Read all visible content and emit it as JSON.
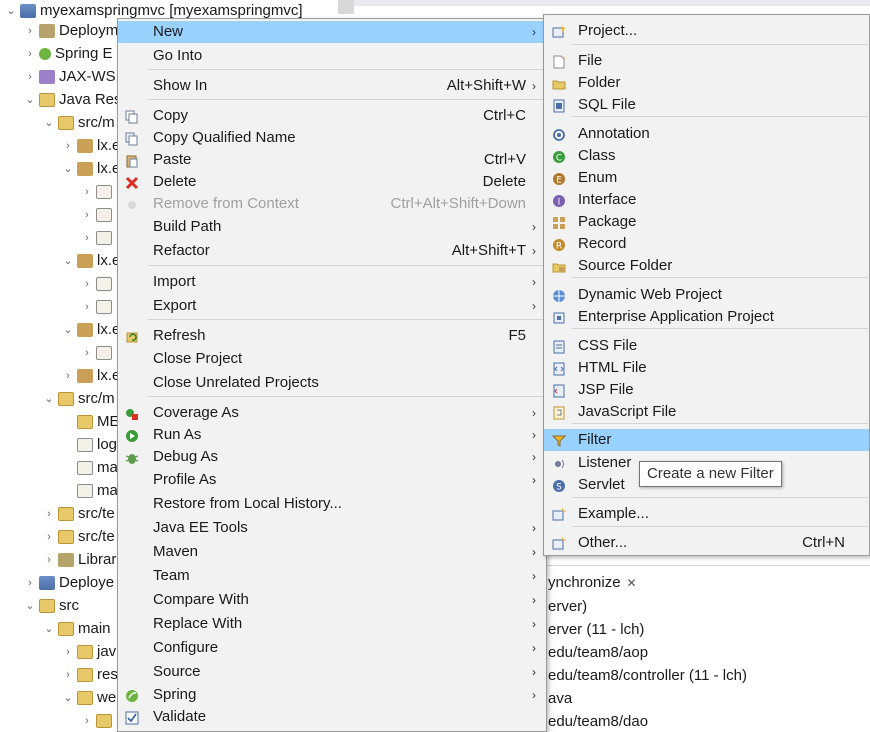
{
  "explorer": {
    "rows": [
      {
        "label": "myexamspringmvc [myexamspringmvc]",
        "icon": "project-icon"
      },
      {
        "label": "Deploym",
        "icon": "deployment-descriptor-icon"
      },
      {
        "label": "Spring E",
        "icon": "spring-icon"
      },
      {
        "label": "JAX-WS",
        "icon": "jaxws-icon"
      },
      {
        "label": "Java Res",
        "icon": "java-resources-icon"
      },
      {
        "label": "src/m",
        "icon": "source-folder-icon"
      },
      {
        "label": "lx.e",
        "icon": "package-icon"
      },
      {
        "label": "lx.e",
        "icon": "package-icon"
      },
      {
        "label": "",
        "icon": "java-file-icon"
      },
      {
        "label": "",
        "icon": "java-file-icon"
      },
      {
        "label": "",
        "icon": "java-file-icon"
      },
      {
        "label": "lx.e",
        "icon": "package-icon"
      },
      {
        "label": "",
        "icon": "java-file-icon"
      },
      {
        "label": "",
        "icon": "java-file-icon"
      },
      {
        "label": "lx.e",
        "icon": "package-icon"
      },
      {
        "label": "",
        "icon": "java-file-icon"
      },
      {
        "label": "lx.e",
        "icon": "package-icon"
      },
      {
        "label": "src/m",
        "icon": "source-folder-icon"
      },
      {
        "label": "ME",
        "icon": "folder-icon"
      },
      {
        "label": "log",
        "icon": "xml-file-icon"
      },
      {
        "label": "ma",
        "icon": "xml-file-icon"
      },
      {
        "label": "ma",
        "icon": "xml-file-icon"
      },
      {
        "label": "src/te",
        "icon": "source-folder-icon"
      },
      {
        "label": "src/te",
        "icon": "source-folder-icon"
      },
      {
        "label": "Librar",
        "icon": "library-icon"
      },
      {
        "label": "Deploye",
        "icon": "deployed-resources-icon"
      },
      {
        "label": "src",
        "icon": "folder-icon"
      },
      {
        "label": "main",
        "icon": "folder-icon"
      },
      {
        "label": "jav",
        "icon": "folder-icon"
      },
      {
        "label": "res",
        "icon": "folder-icon"
      },
      {
        "label": "we",
        "icon": "folder-icon"
      },
      {
        "label": "",
        "icon": "folder-icon"
      }
    ]
  },
  "context_menu": {
    "items": [
      {
        "label": "New",
        "shortcut": "",
        "submenu": true,
        "icon": "",
        "highlight": true
      },
      {
        "label": "Go Into",
        "shortcut": "",
        "submenu": false,
        "icon": ""
      },
      {
        "label": "Show In",
        "shortcut": "Alt+Shift+W",
        "submenu": true,
        "icon": ""
      },
      {
        "label": "Copy",
        "shortcut": "Ctrl+C",
        "submenu": false,
        "icon": "copy-icon"
      },
      {
        "label": "Copy Qualified Name",
        "shortcut": "",
        "submenu": false,
        "icon": "copy-qualified-name-icon"
      },
      {
        "label": "Paste",
        "shortcut": "Ctrl+V",
        "submenu": false,
        "icon": "paste-icon"
      },
      {
        "label": "Delete",
        "shortcut": "Delete",
        "submenu": false,
        "icon": "delete-icon"
      },
      {
        "label": "Remove from Context",
        "shortcut": "Ctrl+Alt+Shift+Down",
        "submenu": false,
        "icon": "remove-from-context-icon",
        "disabled": true
      },
      {
        "label": "Build Path",
        "shortcut": "",
        "submenu": true,
        "icon": ""
      },
      {
        "label": "Refactor",
        "shortcut": "Alt+Shift+T",
        "submenu": true,
        "icon": ""
      },
      {
        "label": "Import",
        "shortcut": "",
        "submenu": true,
        "icon": ""
      },
      {
        "label": "Export",
        "shortcut": "",
        "submenu": true,
        "icon": ""
      },
      {
        "label": "Refresh",
        "shortcut": "F5",
        "submenu": false,
        "icon": "refresh-icon"
      },
      {
        "label": "Close Project",
        "shortcut": "",
        "submenu": false,
        "icon": ""
      },
      {
        "label": "Close Unrelated Projects",
        "shortcut": "",
        "submenu": false,
        "icon": ""
      },
      {
        "label": "Coverage As",
        "shortcut": "",
        "submenu": true,
        "icon": "coverage-icon"
      },
      {
        "label": "Run As",
        "shortcut": "",
        "submenu": true,
        "icon": "run-icon"
      },
      {
        "label": "Debug As",
        "shortcut": "",
        "submenu": true,
        "icon": "debug-icon"
      },
      {
        "label": "Profile As",
        "shortcut": "",
        "submenu": true,
        "icon": ""
      },
      {
        "label": "Restore from Local History...",
        "shortcut": "",
        "submenu": false,
        "icon": ""
      },
      {
        "label": "Java EE Tools",
        "shortcut": "",
        "submenu": true,
        "icon": ""
      },
      {
        "label": "Maven",
        "shortcut": "",
        "submenu": true,
        "icon": ""
      },
      {
        "label": "Team",
        "shortcut": "",
        "submenu": true,
        "icon": ""
      },
      {
        "label": "Compare With",
        "shortcut": "",
        "submenu": true,
        "icon": ""
      },
      {
        "label": "Replace With",
        "shortcut": "",
        "submenu": true,
        "icon": ""
      },
      {
        "label": "Configure",
        "shortcut": "",
        "submenu": true,
        "icon": ""
      },
      {
        "label": "Source",
        "shortcut": "",
        "submenu": true,
        "icon": ""
      },
      {
        "label": "Spring",
        "shortcut": "",
        "submenu": true,
        "icon": "spring-icon"
      },
      {
        "label": "Validate",
        "shortcut": "",
        "submenu": false,
        "icon": "validate-checkbox-icon"
      }
    ]
  },
  "submenu_new": {
    "items": [
      {
        "label": "Project...",
        "shortcut": "",
        "icon": "new-project-icon"
      },
      {
        "label": "File",
        "shortcut": "",
        "icon": "new-file-icon"
      },
      {
        "label": "Folder",
        "shortcut": "",
        "icon": "new-folder-icon"
      },
      {
        "label": "SQL File",
        "shortcut": "",
        "icon": "sql-file-icon"
      },
      {
        "label": "Annotation",
        "shortcut": "",
        "icon": "annotation-icon"
      },
      {
        "label": "Class",
        "shortcut": "",
        "icon": "class-icon"
      },
      {
        "label": "Enum",
        "shortcut": "",
        "icon": "enum-icon"
      },
      {
        "label": "Interface",
        "shortcut": "",
        "icon": "interface-icon"
      },
      {
        "label": "Package",
        "shortcut": "",
        "icon": "package-icon"
      },
      {
        "label": "Record",
        "shortcut": "",
        "icon": "record-icon"
      },
      {
        "label": "Source Folder",
        "shortcut": "",
        "icon": "source-folder-icon"
      },
      {
        "label": "Dynamic Web Project",
        "shortcut": "",
        "icon": "dynamic-web-project-icon"
      },
      {
        "label": "Enterprise Application Project",
        "shortcut": "",
        "icon": "enterprise-application-project-icon"
      },
      {
        "label": "CSS File",
        "shortcut": "",
        "icon": "css-file-icon"
      },
      {
        "label": "HTML File",
        "shortcut": "",
        "icon": "html-file-icon"
      },
      {
        "label": "JSP File",
        "shortcut": "",
        "icon": "jsp-file-icon"
      },
      {
        "label": "JavaScript File",
        "shortcut": "",
        "icon": "javascript-file-icon"
      },
      {
        "label": "Filter",
        "shortcut": "",
        "icon": "filter-icon",
        "highlight": true
      },
      {
        "label": "Listener",
        "shortcut": "",
        "icon": "listener-icon"
      },
      {
        "label": "Servlet",
        "shortcut": "",
        "icon": "servlet-icon"
      },
      {
        "label": "Example...",
        "shortcut": "",
        "icon": "example-icon"
      },
      {
        "label": "Other...",
        "shortcut": "Ctrl+N",
        "icon": "other-wizard-icon"
      }
    ]
  },
  "tooltip": {
    "text": "Create a new Filter"
  },
  "sync_view": {
    "tab_label": "ynchronize",
    "subtitle": "erver)",
    "rows": [
      "erver (11 - lch)",
      "edu/team8/aop",
      "edu/team8/controller (11 - lch)",
      "ava",
      "edu/team8/dao"
    ]
  },
  "colors": {
    "menu_background": "#f2f2f2",
    "highlight": "#99d1ff",
    "disabled_text": "#a0a0a0",
    "separator": "#d4d4d4"
  }
}
